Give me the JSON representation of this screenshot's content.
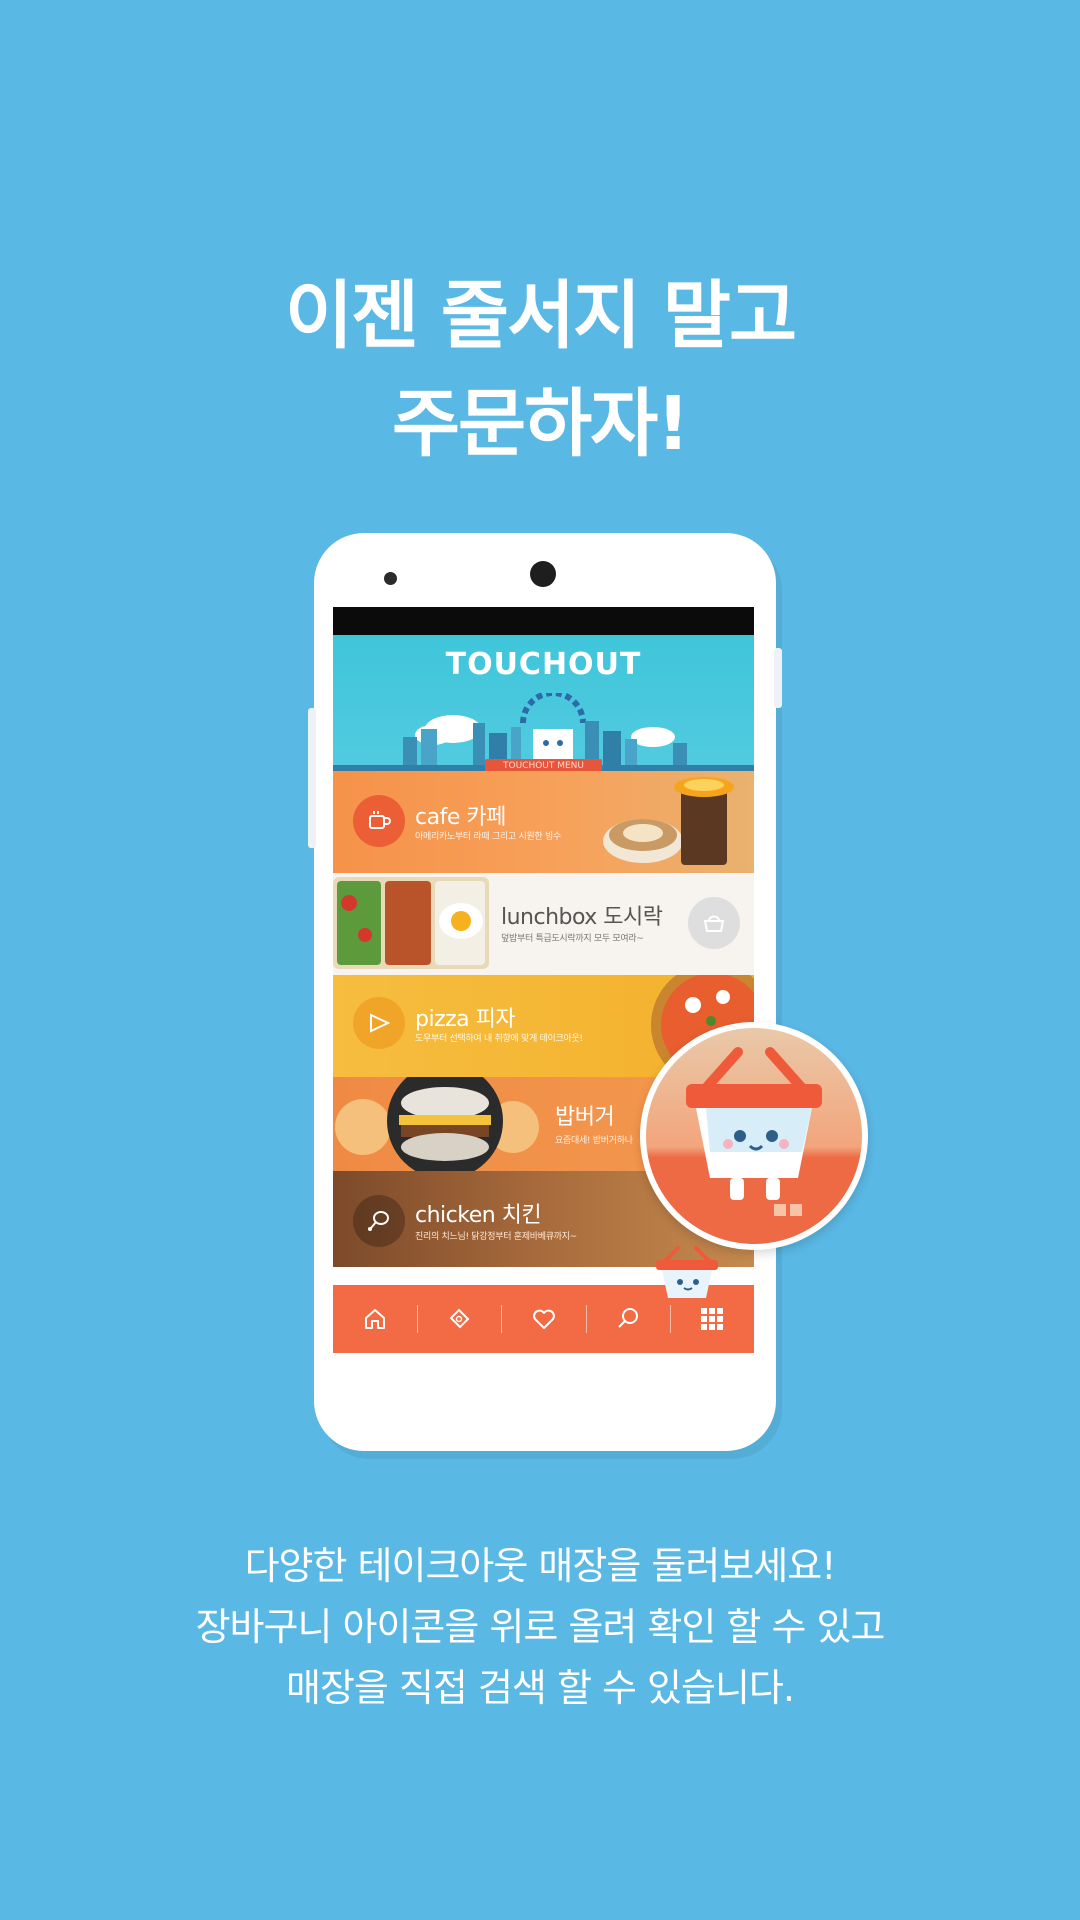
{
  "headline": {
    "line1": "이젠 줄서지 말고",
    "line2": "주문하자!"
  },
  "caption": {
    "line1": "다양한 테이크아웃 매장을 둘러보세요!",
    "line2": "장바구니 아이콘을 위로 올려 확인 할 수 있고",
    "line3": "매장을 직접 검색 할 수 있습니다."
  },
  "app": {
    "brand": "TOUCHOUT",
    "menu_ribbon": "TOUCHOUT MENU",
    "categories": [
      {
        "title": "cafe 카페",
        "subtitle": "아메리카노부터 라떼 그리고 시원한 빙수",
        "icon": "coffee-cup-icon"
      },
      {
        "title": "lunchbox 도시락",
        "subtitle": "덮밥부터 특급도시락까지 모두 모여라~",
        "icon": "lunchbox-icon"
      },
      {
        "title": "pizza 피자",
        "subtitle": "도우부터 선택하여 내 취향에 맞게 테이크아웃!",
        "icon": "pizza-slice-icon"
      },
      {
        "title": "밥버거",
        "subtitle": "요즘대세! 밥버거하나",
        "icon": "burger-icon"
      },
      {
        "title": "chicken 치킨",
        "subtitle": "진리의 치느님! 닭강정부터 훈제바베큐까지~",
        "icon": "drumstick-icon"
      }
    ],
    "nav": [
      {
        "name": "home",
        "icon": "home-icon"
      },
      {
        "name": "coupon",
        "icon": "coupon-icon"
      },
      {
        "name": "favorites",
        "icon": "heart-icon"
      },
      {
        "name": "search",
        "icon": "search-icon"
      },
      {
        "name": "menu-grid",
        "icon": "grid-icon"
      }
    ]
  },
  "colors": {
    "background": "#5ab8e4",
    "accent": "#f26b45",
    "banner": "#47c8dd",
    "pizza": "#f6bd3f"
  }
}
